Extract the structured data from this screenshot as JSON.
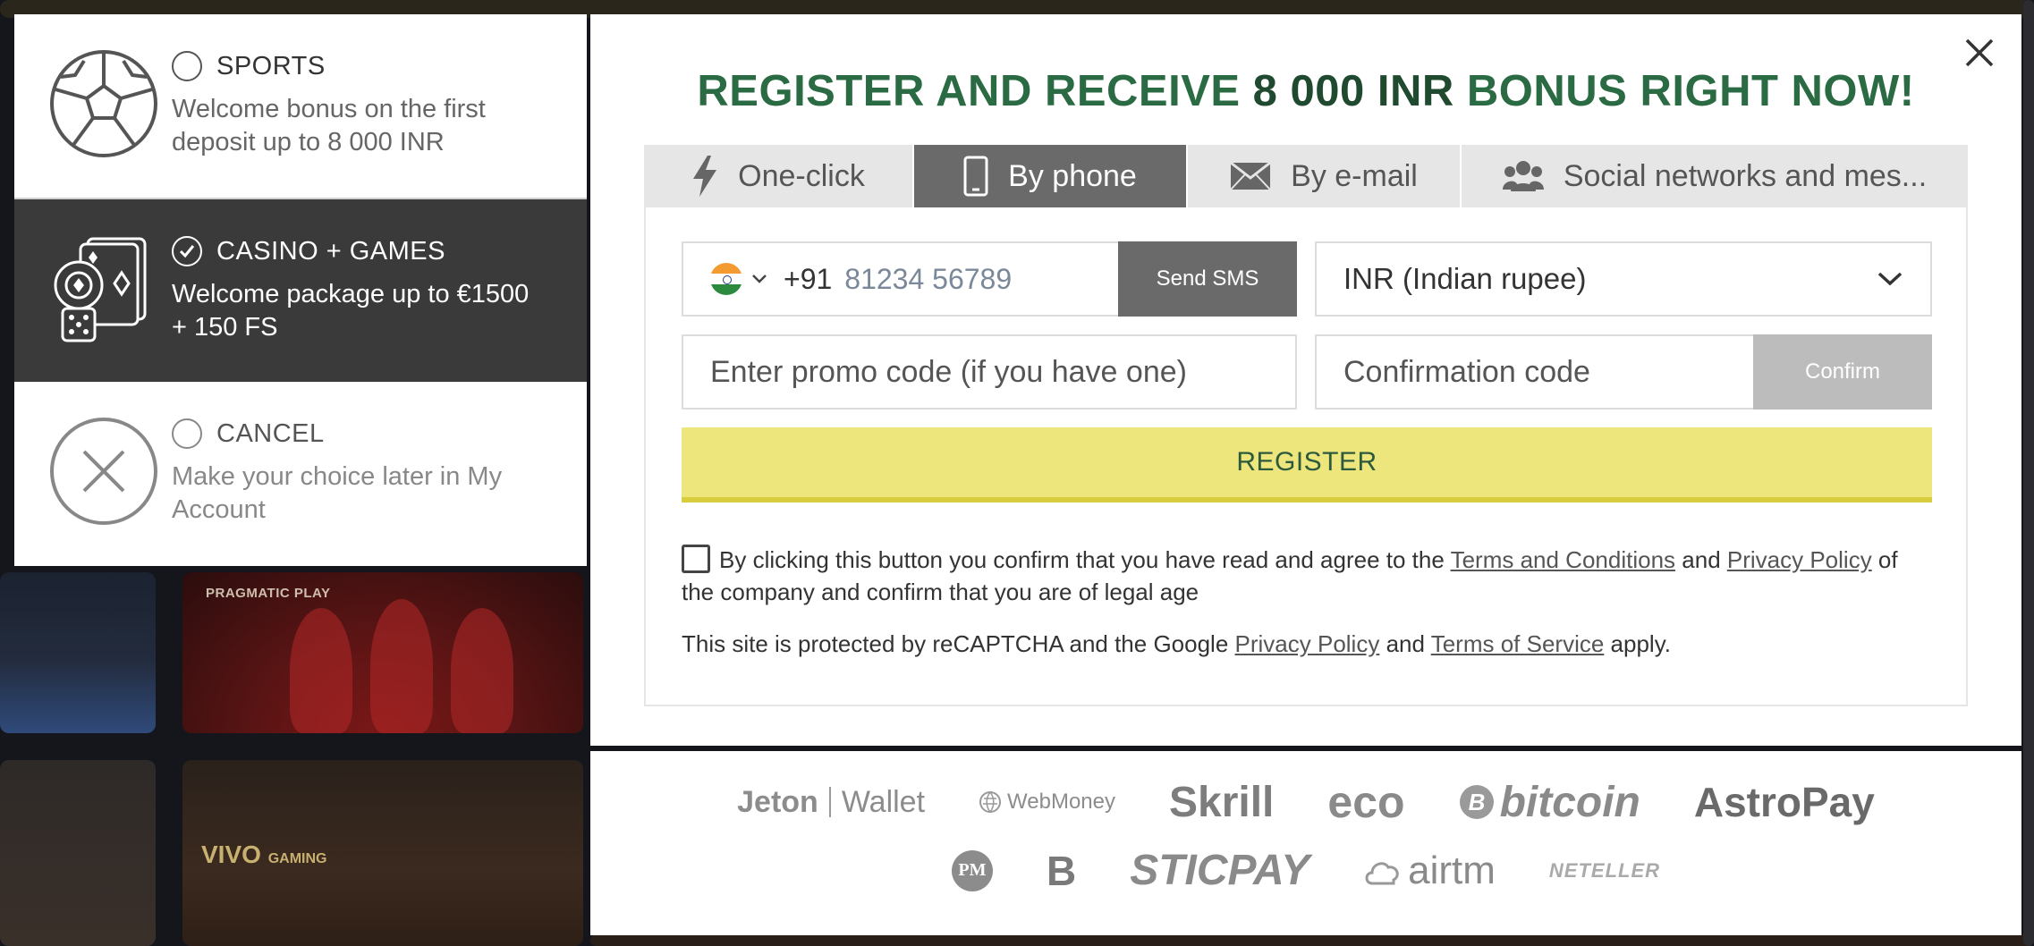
{
  "choices": {
    "sports": {
      "title": "SPORTS",
      "desc": "Welcome bonus on the first deposit up to 8 000 INR",
      "selected": false
    },
    "casino": {
      "title": "CASINO + GAMES",
      "desc": "Welcome package up to €1500 + 150 FS",
      "selected": true
    },
    "cancel": {
      "title": "CANCEL",
      "desc": "Make your choice later in My Account",
      "selected": false
    }
  },
  "modal": {
    "headline_prefix": "REGISTER AND RECEIVE ",
    "headline_amount": "8 000 INR",
    "headline_suffix": " BONUS RIGHT NOW!",
    "tabs": [
      {
        "label": "One-click",
        "icon": "lightning-icon",
        "active": false
      },
      {
        "label": "By phone",
        "icon": "mobile-phone-icon",
        "active": true
      },
      {
        "label": "By e-mail",
        "icon": "envelope-icon",
        "active": false
      },
      {
        "label": "Social networks and mes...",
        "icon": "users-icon",
        "active": false
      }
    ],
    "phone": {
      "country_code": "+91",
      "placeholder": "81234 56789",
      "send_sms_label": "Send SMS"
    },
    "currency": {
      "selected": "INR (Indian rupee)"
    },
    "promo": {
      "placeholder": "Enter promo code (if you have one)"
    },
    "confirmation": {
      "placeholder": "Confirmation code",
      "confirm_label": "Confirm"
    },
    "register_label": "REGISTER",
    "agree": {
      "text1": "By clicking this button you confirm that you have read and agree to the ",
      "terms_link": "Terms and Conditions",
      "text2": " and ",
      "privacy_link": "Privacy Policy",
      "text3": " of the company and confirm that you are of legal age",
      "checked": false
    },
    "captcha": {
      "text1": "This site is protected by reCAPTCHA and the Google ",
      "privacy_link": "Privacy Policy",
      "text2": " and ",
      "tos_link": "Terms of Service",
      "text3": " apply."
    }
  },
  "payments": {
    "row1": [
      "Jeton",
      "Wallet",
      "WebMoney",
      "Skrill",
      "eco",
      "bitcoin",
      "AstroPay"
    ],
    "row2": [
      "PM",
      "B",
      "STICPAY",
      "airtm",
      "NETELLER"
    ]
  },
  "background": {
    "pragmatic_label": "PRAGMATIC PLAY",
    "vivo_label": "VIVO",
    "vivo_sub": "GAMING"
  },
  "colors": {
    "headline_green": "#2b6b44",
    "register_yellow": "#ede67c",
    "active_tab": "#6a6a6a",
    "casino_bg": "#3a3a3a"
  }
}
